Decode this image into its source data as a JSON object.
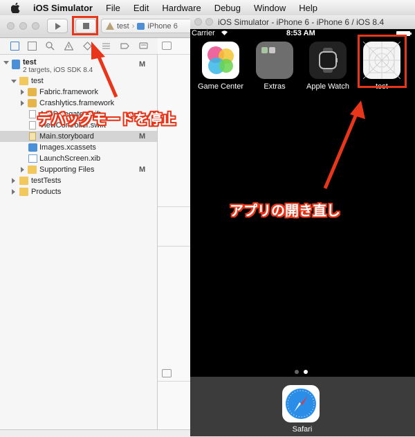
{
  "menubar": {
    "app_name": "iOS Simulator",
    "items": [
      "File",
      "Edit",
      "Hardware",
      "Debug",
      "Window",
      "Help"
    ]
  },
  "xcode": {
    "scheme": {
      "target": "test",
      "device": "iPhone 6"
    },
    "navigator": {
      "project": {
        "name": "test",
        "subtitle": "2 targets, iOS SDK 8.4",
        "status": "M"
      },
      "items": [
        {
          "label": "test",
          "status": "",
          "icon": "folder"
        },
        {
          "label": "Fabric.framework",
          "status": "",
          "icon": "toolbox"
        },
        {
          "label": "Crashlytics.framework",
          "status": "",
          "icon": "toolbox"
        },
        {
          "label": "AppDelegate.swift",
          "status": "",
          "icon": "swift-file"
        },
        {
          "label": "ViewController.swift",
          "status": "",
          "icon": "swift-file"
        },
        {
          "label": "Main.storyboard",
          "status": "M",
          "icon": "storyboard"
        },
        {
          "label": "Images.xcassets",
          "status": "",
          "icon": "assets"
        },
        {
          "label": "LaunchScreen.xib",
          "status": "",
          "icon": "xib"
        },
        {
          "label": "Supporting Files",
          "status": "M",
          "icon": "folder"
        },
        {
          "label": "testTests",
          "status": "",
          "icon": "folder"
        },
        {
          "label": "Products",
          "status": "",
          "icon": "folder"
        }
      ]
    }
  },
  "simulator": {
    "title": "iOS Simulator - iPhone 6 - iPhone 6 / iOS 8.4",
    "status": {
      "carrier": "Carrier",
      "time": "8:53 AM"
    },
    "apps": [
      {
        "label": "Game Center",
        "icon": "game-center"
      },
      {
        "label": "Extras",
        "icon": "folder"
      },
      {
        "label": "Apple Watch",
        "icon": "apple-watch"
      },
      {
        "label": "test",
        "icon": "blank-app"
      }
    ],
    "dock": [
      {
        "label": "Safari",
        "icon": "safari"
      }
    ]
  },
  "annotations": {
    "stop_debug": "デバッグモードを停止",
    "reopen_app": "アプリの開き直し"
  },
  "colors": {
    "annotation_red": "#e8361b",
    "selection": "#d4d4d4"
  }
}
